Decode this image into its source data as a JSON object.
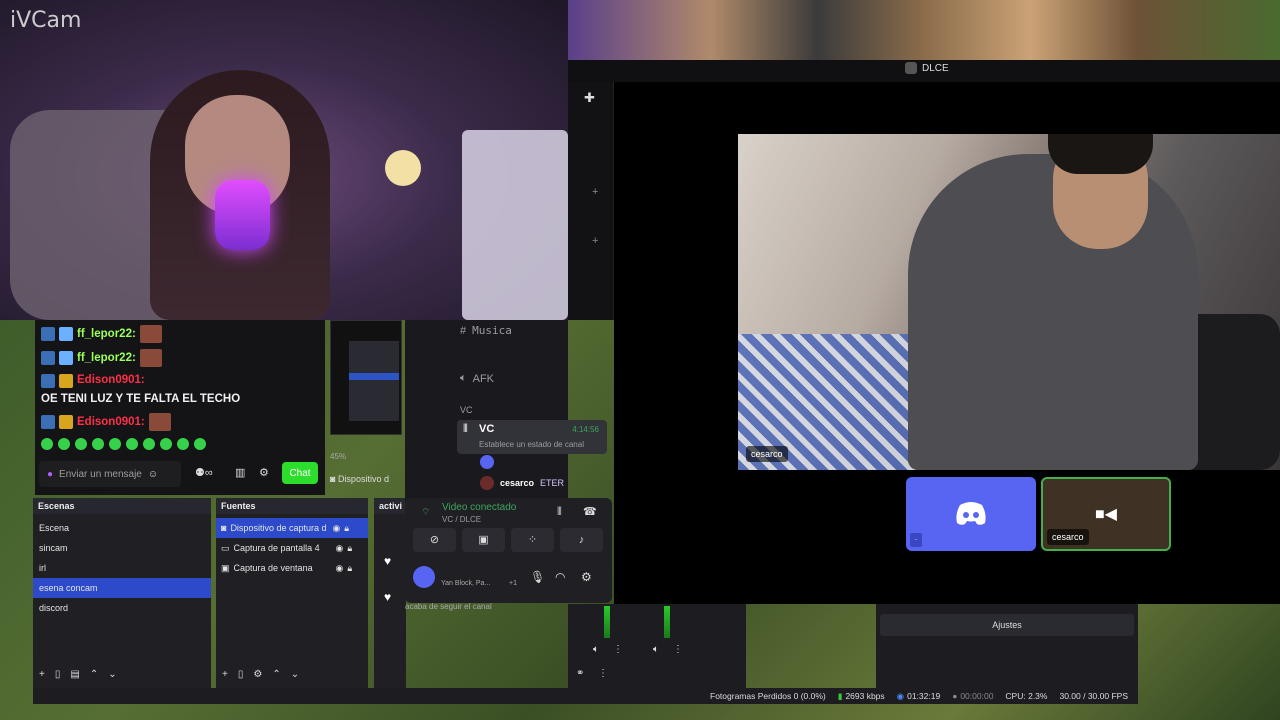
{
  "webcam": {
    "watermark": "iVCam"
  },
  "chat": {
    "messages": [
      {
        "user": "ff_lepor22:",
        "text": ""
      },
      {
        "user": "ff_lepor22:",
        "text": ""
      },
      {
        "user": "Edison0901:",
        "text": "OE TENI LUZ Y TE FALTA EL TECHO"
      },
      {
        "user": "Edison0901:",
        "text": ""
      }
    ],
    "input_placeholder": "Enviar un mensaje",
    "send_label": "Chat"
  },
  "mini_preview": {
    "zoom": "45%",
    "device_label": "Dispositivo d"
  },
  "obs": {
    "scenes_title": "Escenas",
    "scenes": [
      "Escena",
      "sincam",
      "irl",
      "esena concam",
      "discord"
    ],
    "sources_title": "Fuentes",
    "sources": [
      "Dispositivo de captura d",
      "Captura de pantalla 4",
      "Captura de ventana"
    ],
    "activity_title": "activi",
    "activity_follow": "acaba de seguir el canal",
    "settings_label": "Ajustes",
    "status": {
      "dropped": "Fotogramas Perdidos 0 (0.0%)",
      "bitrate": "2693 kbps",
      "live_time": "01:32:19",
      "rec_time": "00:00:00",
      "cpu": "CPU: 2.3%",
      "fps": "30.00 / 30.00 FPS"
    }
  },
  "discord": {
    "server_title": "DLCE",
    "channels": {
      "musica": "Musica",
      "afk": "AFK",
      "vc_category": "VC"
    },
    "vc": {
      "name": "VC",
      "timer": "4:14:56",
      "status": "Establece un estado de canal"
    },
    "member": {
      "name": "cesarco",
      "tag": "ETER"
    },
    "voice_connected": {
      "title": "Video conectado",
      "subtitle": "VC / DLCE"
    },
    "user_panel": {
      "activity": "Yan Block, Pa...",
      "extra": "+1"
    },
    "video_name": "cesarco",
    "cam_tile_name": "cesarco",
    "discord_tile_label": "."
  }
}
